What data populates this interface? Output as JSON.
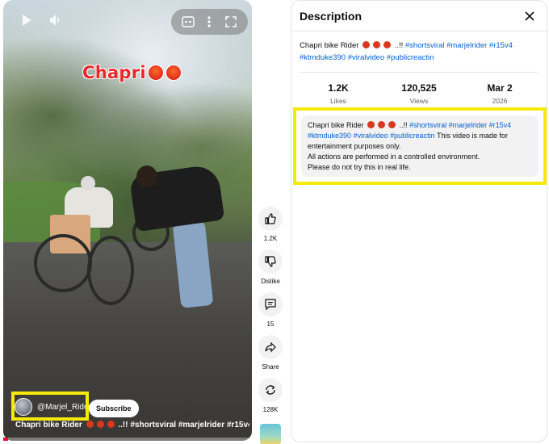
{
  "player": {
    "overlay_text": "Chapri",
    "channel_name": "@Marjel_Rider",
    "subscribe_label": "Subscribe",
    "title_text": "Chapri bike Rider",
    "title_suffix": " ..!! #shortsviral #marjelrider #r15v4 ..."
  },
  "actions": {
    "like_count": "1.2K",
    "dislike_label": "Dislike",
    "comments_count": "15",
    "share_label": "Share",
    "remix_count": "128K"
  },
  "description_panel": {
    "title": "Description",
    "intro_prefix": "Chapri bike Rider",
    "intro_suffix": " ..!! ",
    "hashtags_line1": [
      "#shortsviral",
      "#marjelrider",
      "#r15v4"
    ],
    "hashtags_line2": [
      "#ktmduke390",
      "#viralvideo",
      "#publicreactin"
    ],
    "stats": [
      {
        "value": "1.2K",
        "label": "Likes"
      },
      {
        "value": "120,525",
        "label": "Views"
      },
      {
        "value": "Mar 2",
        "label": "2026"
      }
    ],
    "full_description": {
      "prefix": "Chapri bike Rider",
      "suffix": " ..!! ",
      "tags_a": [
        "#shortsviral",
        "#marjelrider",
        "#r15v4"
      ],
      "tags_b": [
        "#ktmduke390",
        "#viralvideo",
        "#publicreactin"
      ],
      "text_after_tags": " This video is made for entertainment purposes only.",
      "line2": "All actions are performed in a controlled environment.",
      "line3": "Please do not try this in real life."
    }
  },
  "colors": {
    "highlight": "#f5ea0c",
    "link": "#065fd4",
    "progress": "#ff0033"
  },
  "progress_fraction": 0.02
}
